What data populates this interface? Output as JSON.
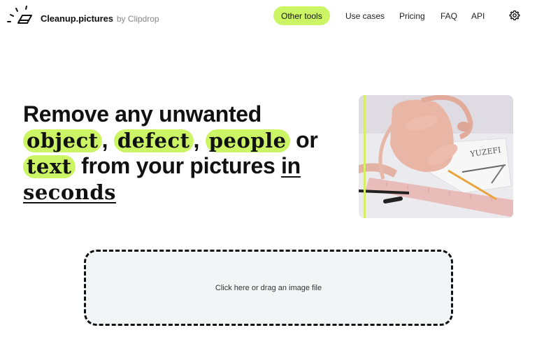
{
  "header": {
    "logo_icon": "eraser-icon",
    "brand_name": "Cleanup.pictures",
    "brand_by": "by Clipdrop",
    "nav": {
      "other_tools": "Other tools",
      "use_cases": "Use cases",
      "pricing": "Pricing",
      "faq": "FAQ",
      "api": "API",
      "settings_icon": "gear-icon"
    }
  },
  "hero": {
    "line1": "Remove any unwanted",
    "highlights": [
      "object",
      "defect",
      "people",
      "text"
    ],
    "comma": ",",
    "or": "or",
    "from_your_pictures": "from your pictures",
    "in": "in",
    "seconds": "seconds",
    "image_alt": "Pink handbag with ruler, pencil, pen and sketches"
  },
  "dropzone": {
    "label": "Click here or drag an image file"
  },
  "colors": {
    "accent": "#ccf566",
    "text": "#111111",
    "dropzone_bg": "#f3f4f6"
  }
}
